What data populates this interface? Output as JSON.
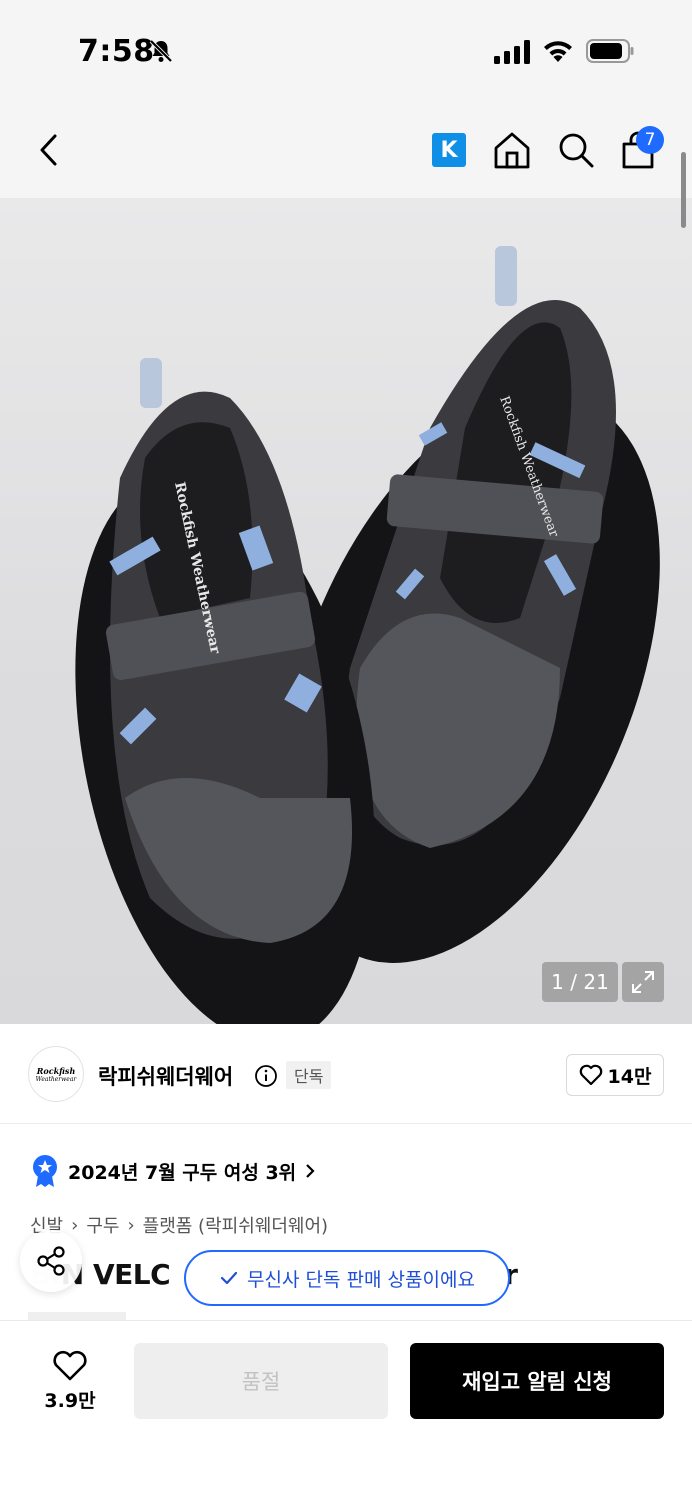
{
  "status_bar": {
    "time": "7:58",
    "icons": [
      "bell-slash-icon",
      "cellular-signal-icon",
      "wifi-icon",
      "battery-icon"
    ]
  },
  "nav": {
    "icons": [
      "chevron-left-icon",
      "k-logo-icon",
      "home-icon",
      "search-icon",
      "shopping-bag-icon"
    ],
    "k_label": "K",
    "cart_count": "7"
  },
  "gallery": {
    "counter": "1 / 21",
    "insole_text": "Rockfish Weatherwear"
  },
  "brand": {
    "name": "락피쉬웨더웨어",
    "badge": "단독",
    "likes": "14만",
    "logo_text_1": "Rockfish",
    "logo_text_2": "Weatherwear"
  },
  "ranking": {
    "text": "2024년 7월 구두 여성 3위"
  },
  "breadcrumb": [
    "신발",
    "구두",
    "플랫폼 (락피쉬웨더웨어)"
  ],
  "product": {
    "title_left": "BI",
    "title_visible_1": "N VELC",
    "title_visible_2": "r"
  },
  "toast": {
    "text": "무신사 단독 판매 상품이에요"
  },
  "bottom_bar": {
    "wish_count": "3.9만",
    "soldout_label": "품절",
    "restock_label": "재입고 알림 신청"
  },
  "colors": {
    "accent_blue": "#1f6aff",
    "k_blue": "#0f8fe6",
    "primary_black": "#000000",
    "disabled_gray": "#eeeeee"
  }
}
